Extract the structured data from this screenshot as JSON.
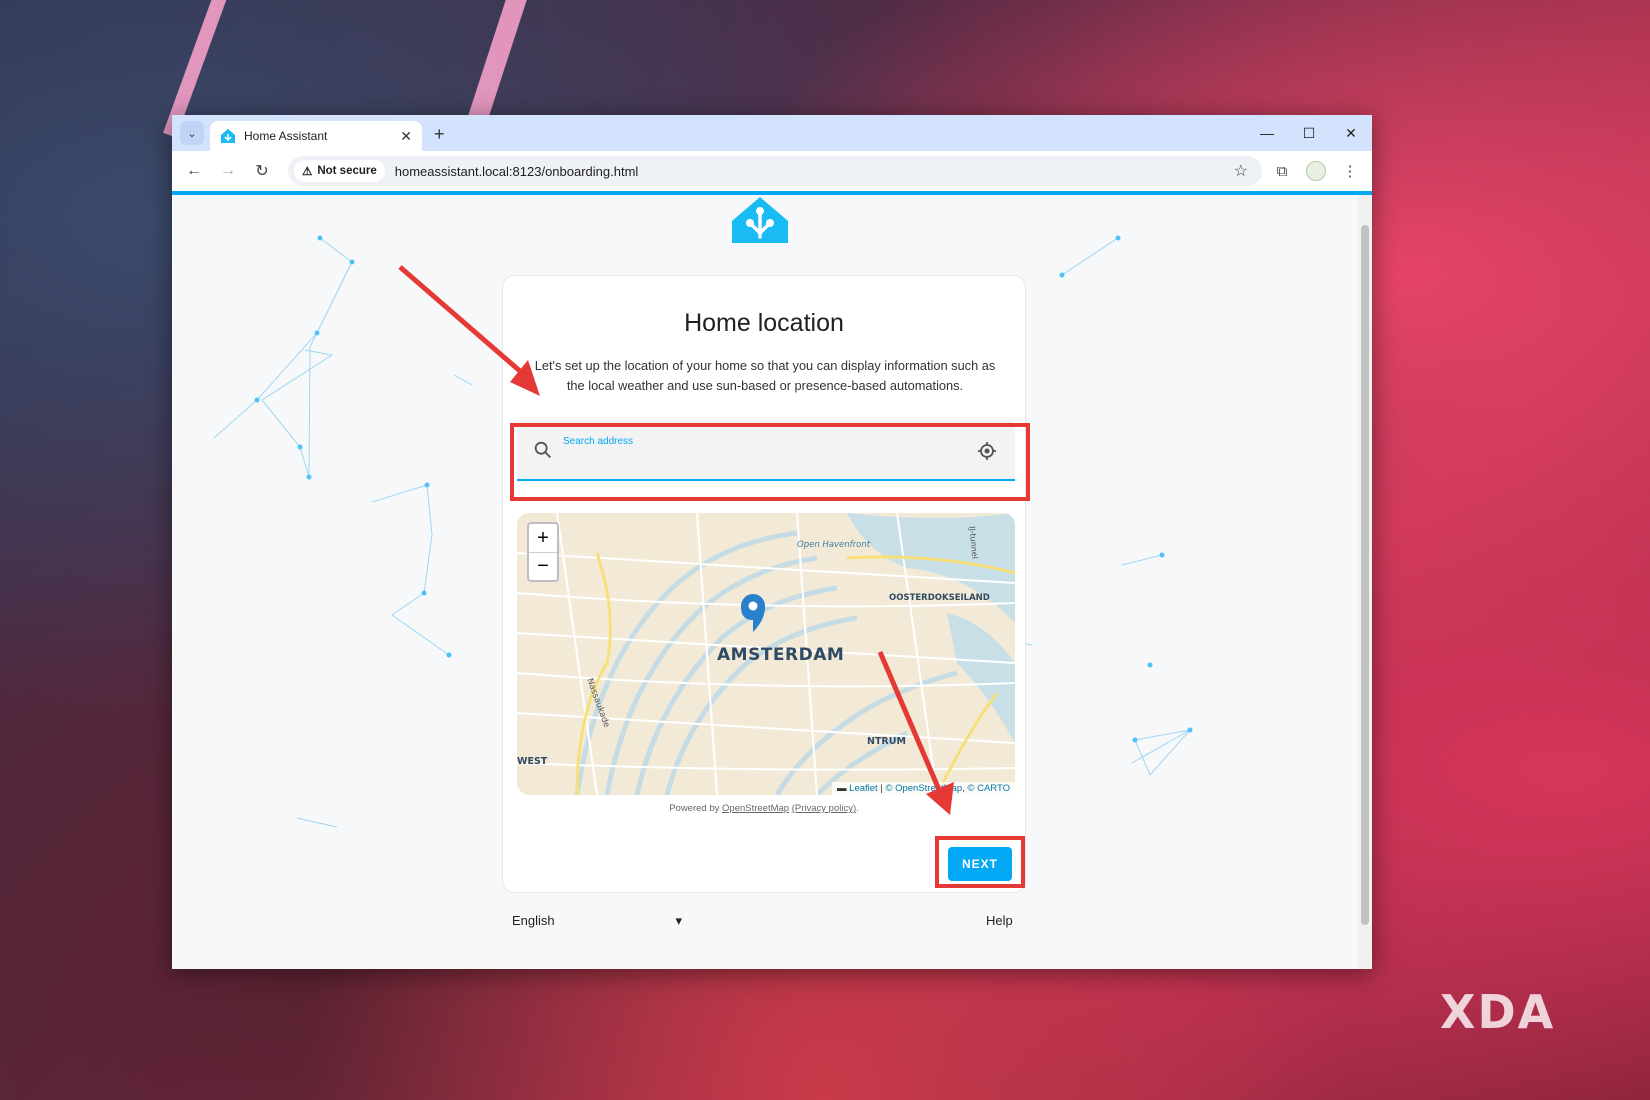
{
  "browser": {
    "tab_title": "Home Assistant",
    "not_secure_label": "Not secure",
    "url": "homeassistant.local:8123/onboarding.html",
    "icons": [
      "back-icon",
      "forward-icon",
      "reload-icon",
      "warning-icon",
      "star-icon",
      "extensions-icon",
      "menu-icon"
    ]
  },
  "onboarding": {
    "title": "Home location",
    "description": "Let's set up the location of your home so that you can display information such as the local weather and use sun-based or presence-based automations.",
    "search_label": "Search address",
    "map": {
      "zoom_in": "+",
      "zoom_out": "−",
      "labels": {
        "city": "AMSTERDAM",
        "oosterdokseiland": "OOSTERDOKSEILAND",
        "open_havenfront": "Open Havenfront",
        "centrum": "NTRUM",
        "west": "WEST",
        "nassaukade": "Nassaukade",
        "tunnel": "IJ-tunnel"
      },
      "attribution_leaflet": "Leaflet",
      "attribution_osm": "© OpenStreetMap",
      "attribution_carto": "© CARTO"
    },
    "powered_prefix": "Powered by ",
    "powered_link": "OpenStreetMap",
    "privacy_link": "(Privacy policy)",
    "next_label": "NEXT"
  },
  "footer": {
    "language": "English",
    "help": "Help"
  },
  "watermark": "XDA",
  "colors": {
    "accent": "#03a9f4",
    "highlight": "#e53935"
  }
}
